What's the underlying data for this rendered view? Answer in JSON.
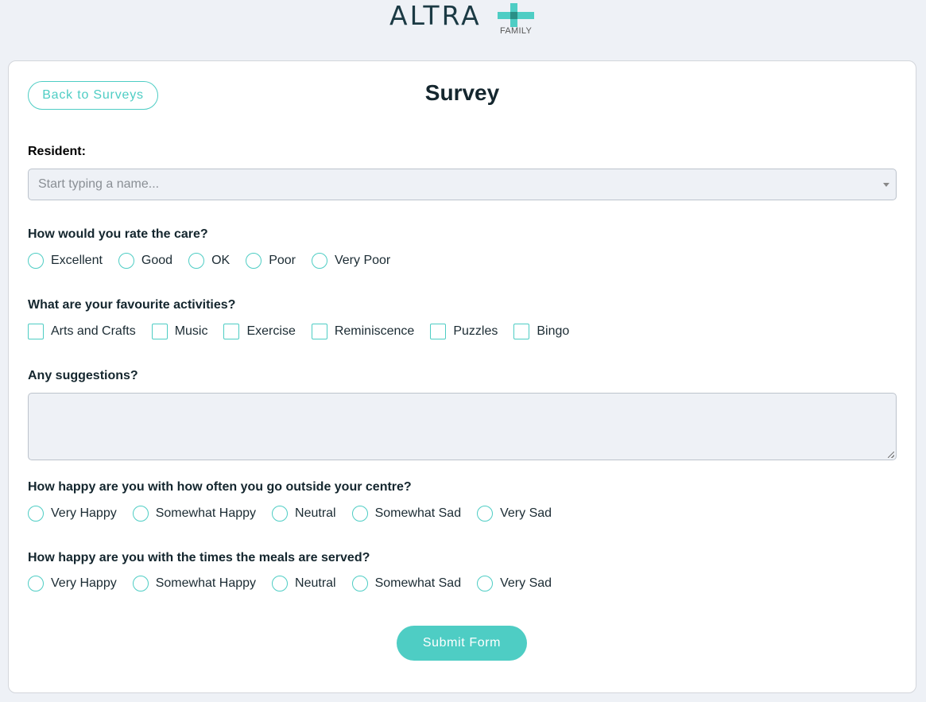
{
  "logo": {
    "text": "ALTRA",
    "subtext": "FAMILY",
    "plus_color_light": "#4ecdc4",
    "plus_color_dark": "#2a8f86"
  },
  "header": {
    "back_label": "Back to Surveys",
    "title": "Survey"
  },
  "resident": {
    "label": "Resident:",
    "placeholder": "Start typing a name..."
  },
  "q1": {
    "label": "How would you rate the care?",
    "options": [
      "Excellent",
      "Good",
      "OK",
      "Poor",
      "Very Poor"
    ]
  },
  "q2": {
    "label": "What are your favourite activities?",
    "options": [
      "Arts and Crafts",
      "Music",
      "Exercise",
      "Reminiscence",
      "Puzzles",
      "Bingo"
    ]
  },
  "q3": {
    "label": "Any suggestions?",
    "value": ""
  },
  "q4": {
    "label": "How happy are you with how often you go outside your centre?",
    "options": [
      "Very Happy",
      "Somewhat Happy",
      "Neutral",
      "Somewhat Sad",
      "Very Sad"
    ]
  },
  "q5": {
    "label": "How happy are you with the times the meals are served?",
    "options": [
      "Very Happy",
      "Somewhat Happy",
      "Neutral",
      "Somewhat Sad",
      "Very Sad"
    ]
  },
  "submit_label": "Submit Form",
  "colors": {
    "accent": "#4ecdc4",
    "background": "#eef1f6",
    "heading": "#14262e"
  }
}
